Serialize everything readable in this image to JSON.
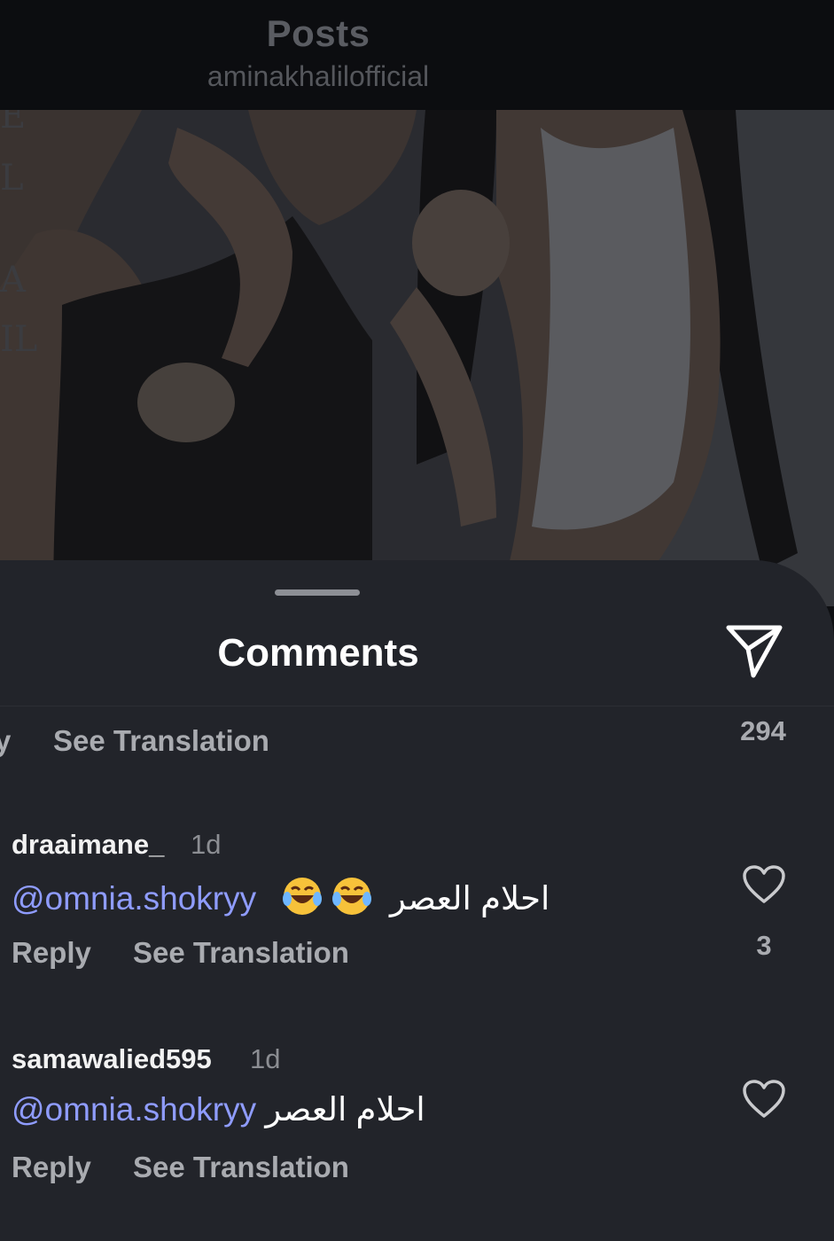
{
  "header": {
    "title": "Posts",
    "subtitle": "aminakhalilofficial"
  },
  "sheet": {
    "title": "Comments"
  },
  "previous_comment": {
    "reply_fragment": "y",
    "see_translation": "See Translation",
    "like_count": "294"
  },
  "comments": [
    {
      "username": "draaimane_",
      "time": "1d",
      "mention": "@omnia.shokryy",
      "emojis": [
        "face-with-tears-of-joy",
        "face-with-tears-of-joy"
      ],
      "text": "احلام العصر",
      "reply_label": "Reply",
      "see_translation": "See Translation",
      "like_count": "3"
    },
    {
      "username": "samawalied595",
      "time": "1d",
      "mention": "@omnia.shokryy",
      "text": "احلام العصر",
      "reply_label": "Reply",
      "see_translation": "See Translation"
    }
  ],
  "icons": {
    "share": "paper-plane-icon",
    "like": "heart-icon"
  },
  "colors": {
    "mention": "#8f9cff",
    "sheet_background": "#22242a",
    "secondary_text": "#a9abb0"
  }
}
